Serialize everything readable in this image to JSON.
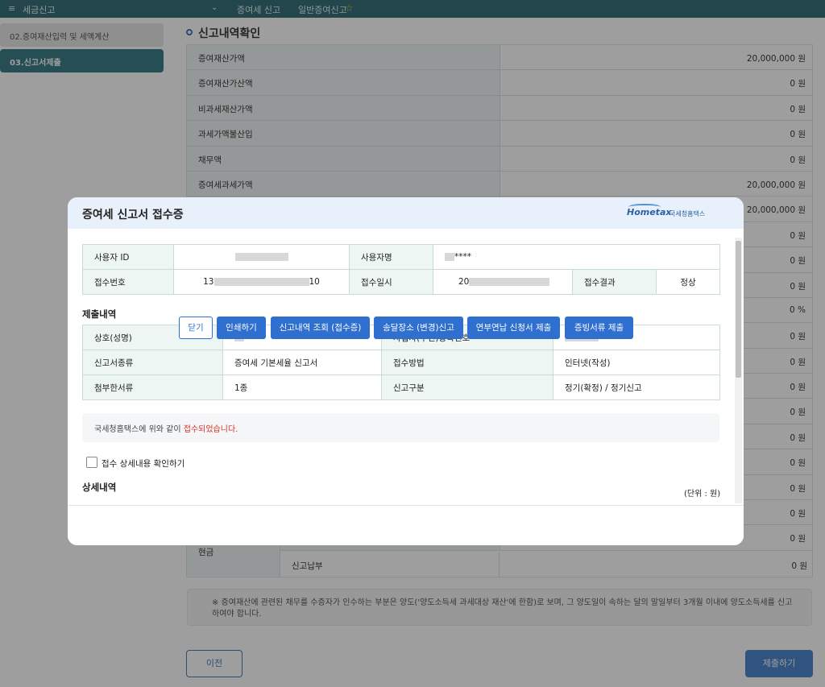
{
  "topbar": {
    "menu_icon": "≡",
    "title": "세금신고",
    "chevron": "⌄",
    "nav1": "증여세 신고",
    "nav2": "일반증여신고",
    "star": "☆"
  },
  "sidebar": {
    "items": [
      {
        "label": "02.증여재산입력 및 세액계산"
      },
      {
        "label": "03.신고서제출"
      }
    ]
  },
  "section": {
    "title": "신고내역확인"
  },
  "bg_table": {
    "rows": [
      {
        "label": "증여재산가액",
        "value": "20,000,000 원"
      },
      {
        "label": "증여재산가산액",
        "value": "0 원"
      },
      {
        "label": "비과세재산가액",
        "value": "0 원"
      },
      {
        "label": "과세가액불산입",
        "value": "0 원"
      },
      {
        "label": "채무액",
        "value": "0 원"
      },
      {
        "label": "증여세과세가액",
        "value": "20,000,000 원"
      },
      {
        "label": "",
        "value": "20,000,000 원"
      },
      {
        "label": "",
        "value": "0 원"
      },
      {
        "label": "",
        "value": "0 원"
      },
      {
        "label": "",
        "value": "0 원"
      },
      {
        "label": "",
        "value": "0 %"
      },
      {
        "label": "",
        "value": "0 원"
      },
      {
        "label": "",
        "value": "0 원"
      },
      {
        "label": "",
        "value": "0 원"
      },
      {
        "label": "",
        "value": "0 원"
      },
      {
        "label": "",
        "value": "0 원"
      },
      {
        "label": "",
        "value": "0 원"
      },
      {
        "label": "",
        "value": "0 원"
      },
      {
        "label": "",
        "value": "0 원"
      },
      {
        "label": "",
        "value": "0 원"
      }
    ],
    "cash_label": "현금",
    "cash_sub_label": "신고납부",
    "cash_value": "0 원"
  },
  "notice": "※ 증여재산에 관련된 채무를 수증자가 인수하는 부분은 양도('양도소득세 과세대상 재산'에 한함)로 보며, 그 양도일이 속하는 달의 말일부터 3개월 이내에 양도소득세를 신고하여야 합니다.",
  "buttons": {
    "prev": "이전",
    "submit": "제출하기"
  },
  "modal": {
    "title": "증여세 신고서 접수증",
    "logo_text": "Hometax",
    "logo_sub": "국세청홈택스",
    "info": {
      "user_id_label": "사용자 ID",
      "user_name_label": "사용자명",
      "user_name_value": "****",
      "receipt_no_label": "접수번호",
      "receipt_no_prefix": "13",
      "receipt_no_suffix": "10",
      "receipt_time_label": "접수일시",
      "receipt_time_prefix": "20",
      "result_label": "접수결과",
      "result_value": "정상"
    },
    "submission": {
      "title": "제출내역",
      "name_label": "상호(성명)",
      "name_value": "****",
      "reg_label": "사업자(주민)등록번호",
      "reg_value": "-*******",
      "type_label": "신고서종류",
      "type_value": "증여세 기본세율 신고서",
      "method_label": "접수방법",
      "method_value": "인터넷(작성)",
      "attach_label": "첨부한서류",
      "attach_value": "1종",
      "category_label": "신고구분",
      "category_value": "정기(확정) / 정기신고"
    },
    "receipt_note_prefix": "국세청홈택스에 위와 같이 ",
    "receipt_note_red": "접수되었습니다.",
    "checkbox_label": "접수 상세내용 확인하기",
    "detail_title": "상세내역",
    "unit": "(단위 : 원)",
    "footer_buttons": {
      "close": "닫기",
      "print": "인쇄하기",
      "history": "신고내역 조회 (접수증)",
      "address": "송달장소 (변경)신고",
      "installment": "연부연납 신청서 제출",
      "evidence": "증빙서류 제출"
    }
  }
}
